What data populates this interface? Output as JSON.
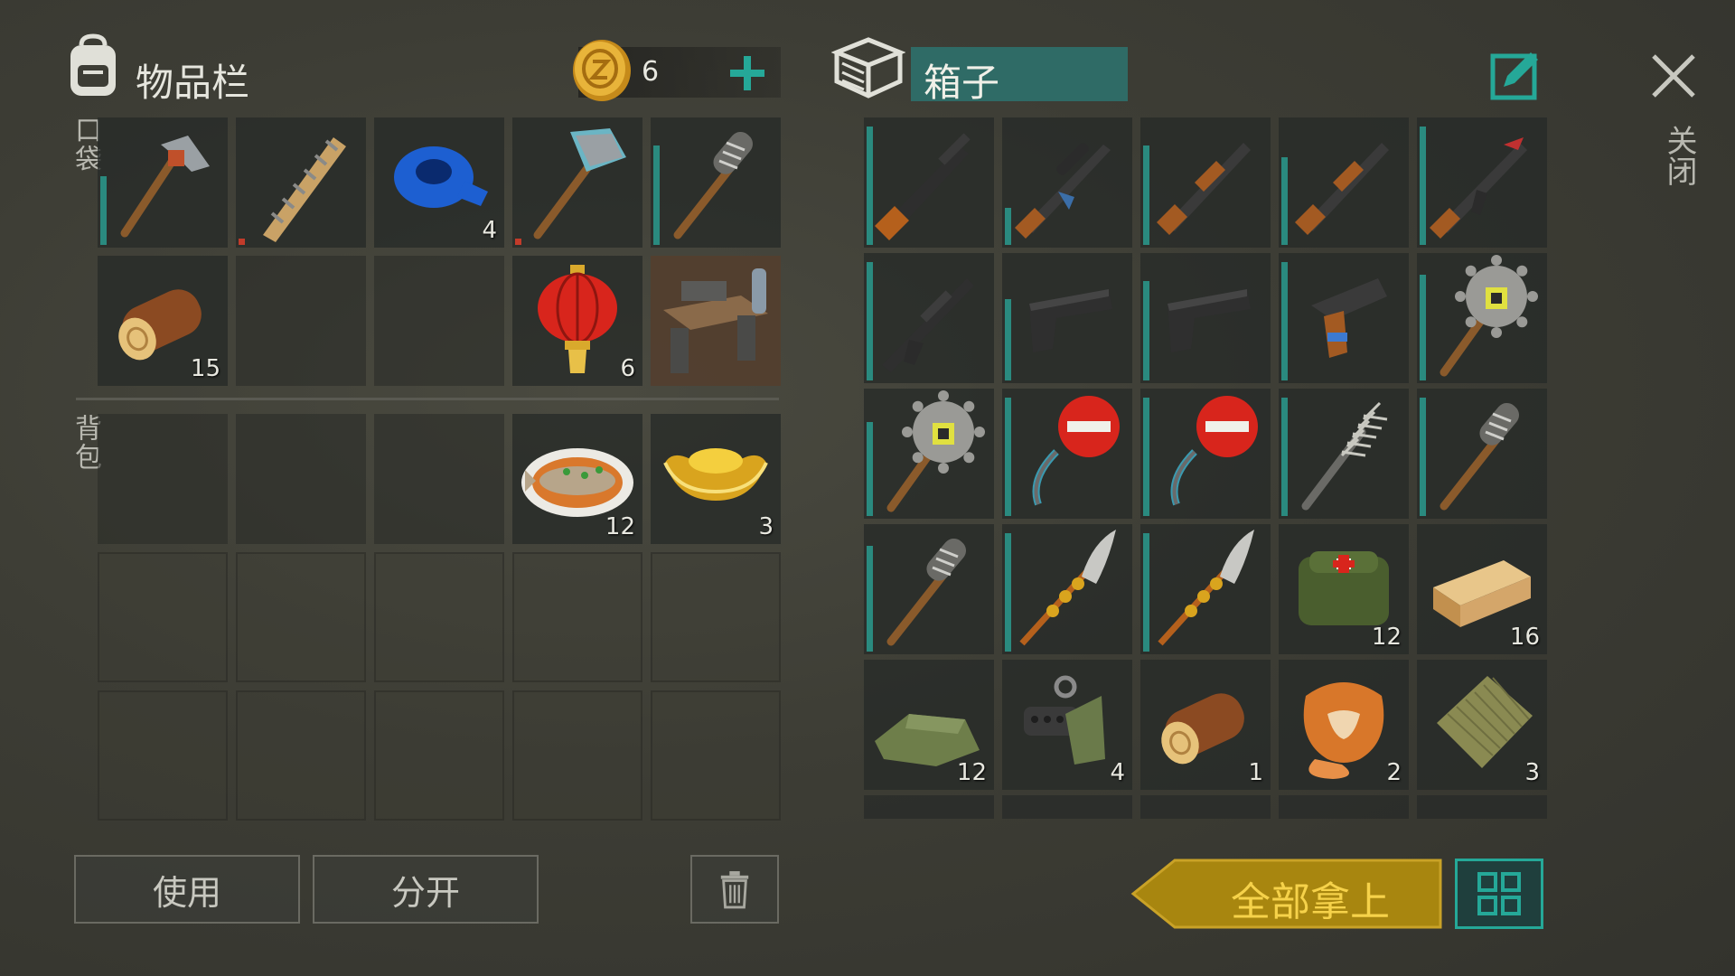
{
  "inventory": {
    "title": "物品栏",
    "coins": "6",
    "pocket_label": "口袋",
    "backpack_label": "背包",
    "pocket": [
      {
        "icon": "hammer-icon",
        "qty": "",
        "bar": 0.55,
        "barColor": "teal"
      },
      {
        "icon": "spiked-bat-icon",
        "qty": "",
        "bar": 0.05,
        "barColor": "red"
      },
      {
        "icon": "duct-tape-icon",
        "qty": "4"
      },
      {
        "icon": "sledgehammer-icon",
        "qty": "",
        "bar": 0.05,
        "barColor": "red"
      },
      {
        "icon": "wrapped-club-icon",
        "qty": "",
        "bar": 0.8,
        "barColor": "teal"
      },
      {
        "icon": "log-icon",
        "qty": "15"
      },
      {
        "icon": "",
        "qty": ""
      },
      {
        "icon": "",
        "qty": ""
      },
      {
        "icon": "red-lantern-icon",
        "qty": "6"
      },
      {
        "icon": "workbench-icon",
        "qty": ""
      }
    ],
    "backpack": [
      {
        "icon": "",
        "qty": ""
      },
      {
        "icon": "",
        "qty": ""
      },
      {
        "icon": "",
        "qty": ""
      },
      {
        "icon": "fish-dish-icon",
        "qty": "12"
      },
      {
        "icon": "gold-ingot-icon",
        "qty": "3"
      }
    ]
  },
  "box": {
    "title": "箱子",
    "slots": [
      {
        "icon": "sniper-rifle-icon",
        "qty": "",
        "bar": 0.95
      },
      {
        "icon": "scoped-ak-icon",
        "qty": "",
        "bar": 0.3
      },
      {
        "icon": "shotgun-icon",
        "qty": "",
        "bar": 0.8
      },
      {
        "icon": "shotgun-icon",
        "qty": "",
        "bar": 0.7
      },
      {
        "icon": "ak-rifle-icon",
        "qty": "",
        "bar": 0.95
      },
      {
        "icon": "assault-rifle-icon",
        "qty": "",
        "bar": 0.95
      },
      {
        "icon": "pistol-icon",
        "qty": "",
        "bar": 0.65
      },
      {
        "icon": "pistol-icon",
        "qty": "",
        "bar": 0.8
      },
      {
        "icon": "flare-gun-icon",
        "qty": "",
        "bar": 0.95
      },
      {
        "icon": "saw-blade-club-icon",
        "qty": "",
        "bar": 0.85
      },
      {
        "icon": "saw-blade-club-icon",
        "qty": "",
        "bar": 0.75
      },
      {
        "icon": "stop-sign-icon",
        "qty": "",
        "bar": 0.95
      },
      {
        "icon": "stop-sign-icon",
        "qty": "",
        "bar": 0.95
      },
      {
        "icon": "barbed-club-icon",
        "qty": "",
        "bar": 0.95
      },
      {
        "icon": "wrapped-club-icon",
        "qty": "",
        "bar": 0.95
      },
      {
        "icon": "wrapped-club-icon",
        "qty": "",
        "bar": 0.85
      },
      {
        "icon": "glaive-icon",
        "qty": "",
        "bar": 0.95
      },
      {
        "icon": "glaive-icon",
        "qty": "",
        "bar": 0.95
      },
      {
        "icon": "medkit-bag-icon",
        "qty": "12"
      },
      {
        "icon": "wood-plank-icon",
        "qty": "16"
      },
      {
        "icon": "cloth-icon",
        "qty": "12"
      },
      {
        "icon": "gun-parts-icon",
        "qty": "4"
      },
      {
        "icon": "log-icon",
        "qty": "1"
      },
      {
        "icon": "fox-fur-icon",
        "qty": "2"
      },
      {
        "icon": "burlap-icon",
        "qty": "3"
      }
    ]
  },
  "buttons": {
    "use": "使用",
    "split": "分开",
    "take_all": "全部拿上",
    "close": "关闭"
  },
  "colors": {
    "teal": "#2a8a7f",
    "red": "#c23b2a",
    "gold": "#c9a227",
    "gold_text": "#f0c030"
  }
}
